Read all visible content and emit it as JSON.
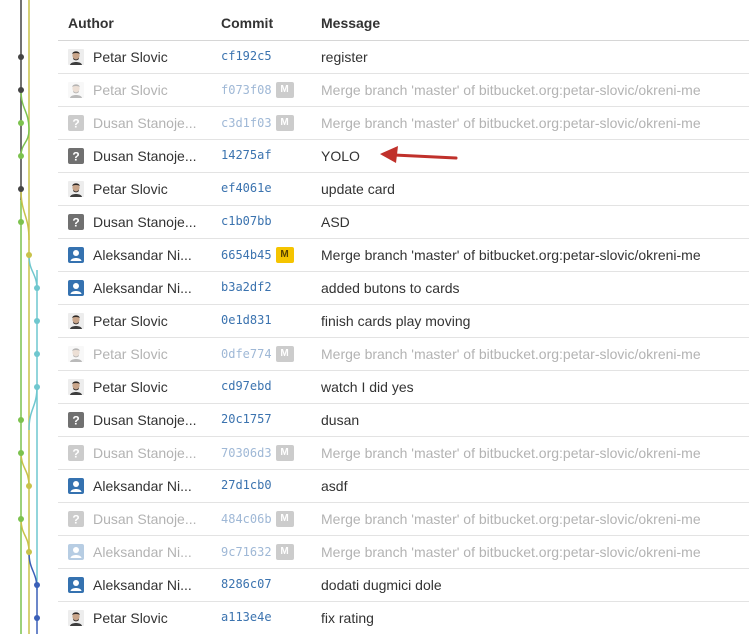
{
  "header": {
    "author": "Author",
    "commit": "Commit",
    "message": "Message"
  },
  "colors": {
    "hash_link": "#3b73af",
    "merge_badge_active": "#f5c400",
    "merge_badge_inactive": "#cccccc",
    "graph_dark": "#444444",
    "graph_green": "#7cc24e",
    "graph_olive": "#c8c24a",
    "graph_cyan": "#6fc7cf",
    "graph_blue": "#3a5fb8",
    "arrow": "#c0312b"
  },
  "rows": [
    {
      "author": "Petar Slovic",
      "avatar": "photo",
      "hash": "cf192c5",
      "merge": "",
      "message": "register",
      "faded": false
    },
    {
      "author": "Petar Slovic",
      "avatar": "photo",
      "hash": "f073f08",
      "merge": "M",
      "message": "Merge branch 'master' of bitbucket.org:petar-slovic/okreni-me",
      "faded": true
    },
    {
      "author": "Dusan Stanoje...",
      "avatar": "unknown",
      "hash": "c3d1f03",
      "merge": "M",
      "message": "Merge branch 'master' of bitbucket.org:petar-slovic/okreni-me",
      "faded": true
    },
    {
      "author": "Dusan Stanoje...",
      "avatar": "unknown",
      "hash": "14275af",
      "merge": "",
      "message": "YOLO",
      "faded": false
    },
    {
      "author": "Petar Slovic",
      "avatar": "photo",
      "hash": "ef4061e",
      "merge": "",
      "message": "update card",
      "faded": false
    },
    {
      "author": "Dusan Stanoje...",
      "avatar": "unknown",
      "hash": "c1b07bb",
      "merge": "",
      "message": "ASD",
      "faded": false
    },
    {
      "author": "Aleksandar Ni...",
      "avatar": "user",
      "hash": "6654b45",
      "merge": "M",
      "message": "Merge branch 'master' of bitbucket.org:petar-slovic/okreni-me",
      "faded": false
    },
    {
      "author": "Aleksandar Ni...",
      "avatar": "user",
      "hash": "b3a2df2",
      "merge": "",
      "message": "added butons to cards",
      "faded": false
    },
    {
      "author": "Petar Slovic",
      "avatar": "photo",
      "hash": "0e1d831",
      "merge": "",
      "message": "finish cards play moving",
      "faded": false
    },
    {
      "author": "Petar Slovic",
      "avatar": "photo",
      "hash": "0dfe774",
      "merge": "M",
      "message": "Merge branch 'master' of bitbucket.org:petar-slovic/okreni-me",
      "faded": true
    },
    {
      "author": "Petar Slovic",
      "avatar": "photo",
      "hash": "cd97ebd",
      "merge": "",
      "message": "watch I did yes",
      "faded": false
    },
    {
      "author": "Dusan Stanoje...",
      "avatar": "unknown",
      "hash": "20c1757",
      "merge": "",
      "message": "dusan",
      "faded": false
    },
    {
      "author": "Dusan Stanoje...",
      "avatar": "unknown",
      "hash": "70306d3",
      "merge": "M",
      "message": "Merge branch 'master' of bitbucket.org:petar-slovic/okreni-me",
      "faded": true
    },
    {
      "author": "Aleksandar Ni...",
      "avatar": "user",
      "hash": "27d1cb0",
      "merge": "",
      "message": "asdf",
      "faded": false
    },
    {
      "author": "Dusan Stanoje...",
      "avatar": "unknown",
      "hash": "484c06b",
      "merge": "M",
      "message": "Merge branch 'master' of bitbucket.org:petar-slovic/okreni-me",
      "faded": true
    },
    {
      "author": "Aleksandar Ni...",
      "avatar": "user",
      "hash": "9c71632",
      "merge": "M",
      "message": "Merge branch 'master' of bitbucket.org:petar-slovic/okreni-me",
      "faded": true
    },
    {
      "author": "Aleksandar Ni...",
      "avatar": "user",
      "hash": "8286c07",
      "merge": "",
      "message": "dodati dugmici dole",
      "faded": false
    },
    {
      "author": "Petar Slovic",
      "avatar": "photo",
      "hash": "a113e4e",
      "merge": "",
      "message": "fix rating",
      "faded": false
    }
  ],
  "graph_nodes": [
    {
      "lane": "dark"
    },
    {
      "lane": "dark"
    },
    {
      "lane": "green"
    },
    {
      "lane": "green"
    },
    {
      "lane": "dark"
    },
    {
      "lane": "green"
    },
    {
      "lane": "olive"
    },
    {
      "lane": "cyan"
    },
    {
      "lane": "cyan"
    },
    {
      "lane": "cyan"
    },
    {
      "lane": "cyan"
    },
    {
      "lane": "green"
    },
    {
      "lane": "green"
    },
    {
      "lane": "olive"
    },
    {
      "lane": "green"
    },
    {
      "lane": "olive"
    },
    {
      "lane": "blue"
    },
    {
      "lane": "blue"
    }
  ]
}
